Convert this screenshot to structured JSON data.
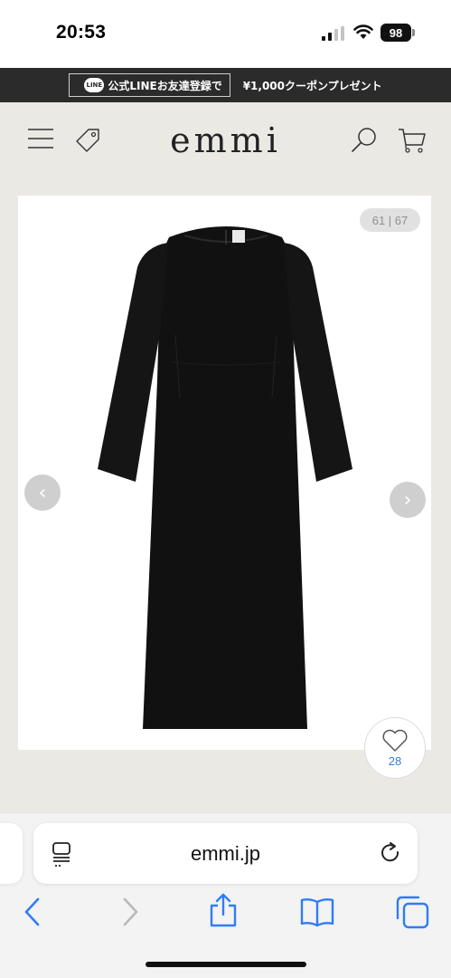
{
  "status_bar": {
    "time": "20:53",
    "battery": "98",
    "icons": [
      "signal-icon",
      "wifi-icon",
      "battery-icon"
    ]
  },
  "promo_banner": {
    "line_badge": "LINE",
    "line_text": "公式LINEお友達登録で",
    "coupon_text": "¥1,000クーポンプレゼント"
  },
  "header": {
    "logo": "emmi",
    "icons": [
      "menu-icon",
      "tag-icon",
      "search-icon",
      "cart-icon"
    ]
  },
  "product_gallery": {
    "counter": "61 | 67",
    "prev_arrow": "‹",
    "next_arrow": "›",
    "image": "black-long-sleeve-dress",
    "favorite_count": "28"
  },
  "browser": {
    "url": "emmi.jp",
    "icons": [
      "reader-icon",
      "reload-icon",
      "back-icon",
      "forward-icon",
      "share-icon",
      "bookmarks-icon",
      "tabs-icon"
    ]
  }
}
